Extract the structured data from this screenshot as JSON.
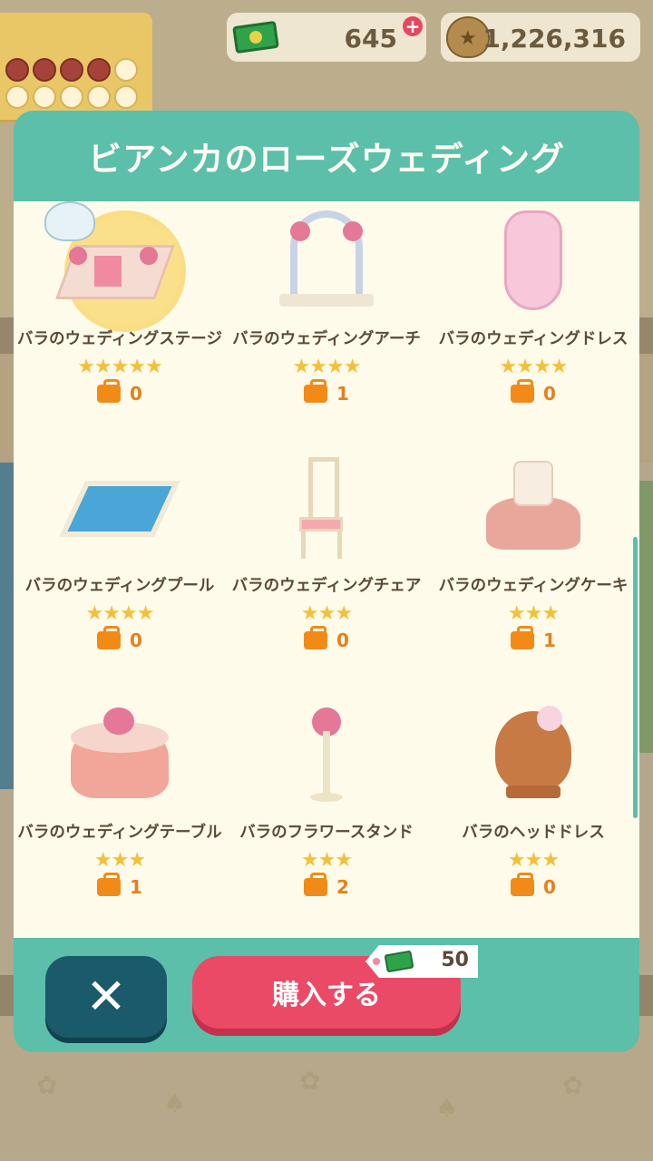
{
  "top_bar": {
    "tickets": "645",
    "bells": "1,226,316"
  },
  "dialog": {
    "title": "ビアンカのローズウェディング",
    "items": [
      {
        "name": "バラのウェディングステージ",
        "stars": "★★★★★",
        "owned": "0"
      },
      {
        "name": "バラのウェディングアーチ",
        "stars": "★★★★",
        "owned": "1"
      },
      {
        "name": "バラのウェディングドレス",
        "stars": "★★★★",
        "owned": "0"
      },
      {
        "name": "バラのウェディングプール",
        "stars": "★★★★",
        "owned": "0"
      },
      {
        "name": "バラのウェディングチェア",
        "stars": "★★★",
        "owned": "0"
      },
      {
        "name": "バラのウェディングケーキ",
        "stars": "★★★",
        "owned": "1"
      },
      {
        "name": "バラのウェディングテーブル",
        "stars": "★★★",
        "owned": "1"
      },
      {
        "name": "バラのフラワースタンド",
        "stars": "★★★",
        "owned": "2"
      },
      {
        "name": "バラのヘッドドレス",
        "stars": "★★★",
        "owned": "0"
      }
    ],
    "buy_label": "購入する",
    "price": "50"
  },
  "colors": {
    "dialog_teal": "#5bbfa9",
    "buy_button": "#ea4a66",
    "close_button": "#1a5a6b",
    "star": "#f4c03a",
    "owned": "#e87f1a"
  },
  "icons": [
    "ticket-icon",
    "plus-icon",
    "bell-bag-icon",
    "fox-icon",
    "bag-icon",
    "close-icon"
  ]
}
